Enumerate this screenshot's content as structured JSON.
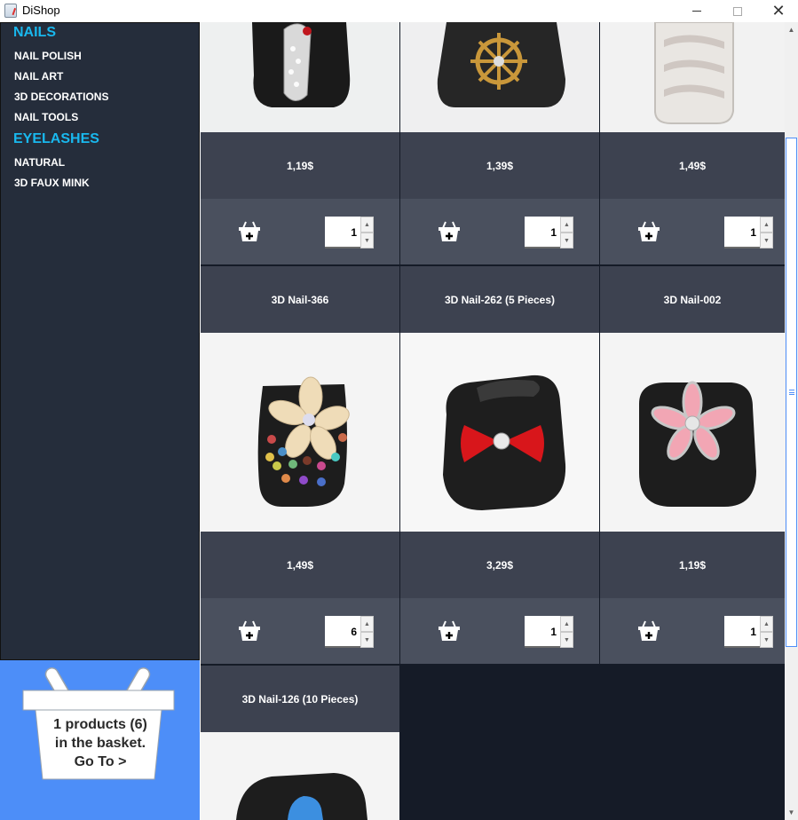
{
  "window": {
    "title": "DiShop",
    "minimize_icon": "minimize-icon",
    "maximize_icon": "maximize-icon",
    "close_icon": "close-icon",
    "close_glyph": "✕"
  },
  "sidebar": {
    "categories": [
      {
        "heading": "NAILS",
        "items": [
          "NAIL POLISH",
          "NAIL ART",
          "3D DECORATIONS",
          "NAIL TOOLS"
        ]
      },
      {
        "heading": "EYELASHES",
        "items": [
          "NATURAL",
          "3D FAUX MINK"
        ]
      }
    ]
  },
  "basket": {
    "line1": "1 products (6)",
    "line2": "in the basket.",
    "line3": "Go To >",
    "icon": "basket-icon"
  },
  "products": {
    "row1": [
      {
        "price": "1,19$",
        "quantity": "1",
        "image": "flip-flop rhinestone nail charm"
      },
      {
        "price": "1,39$",
        "quantity": "1",
        "image": "ship wheel nail charm"
      },
      {
        "price": "1,49$",
        "quantity": "1",
        "image": "wavy rhinestone nail charm"
      }
    ],
    "row2": [
      {
        "name": "3D Nail-366",
        "price": "1,49$",
        "quantity": "6",
        "image": "flower rhinestone nail charm"
      },
      {
        "name": "3D Nail-262 (5 Pieces)",
        "price": "3,29$",
        "quantity": "1",
        "image": "red bow nail charm"
      },
      {
        "name": "3D Nail-002",
        "price": "1,19$",
        "quantity": "1",
        "image": "pink flower nail charm"
      }
    ],
    "row3": [
      {
        "name": "3D Nail-126 (10 Pieces)",
        "image": "blue nail charm"
      }
    ]
  },
  "colors": {
    "sidebar_bg": "#252d3b",
    "heading_accent": "#19b8ee",
    "basket_bg": "#4d8ef8",
    "product_bg": "#151b27",
    "price_row": "#3d4250",
    "action_row": "#4a505e"
  }
}
